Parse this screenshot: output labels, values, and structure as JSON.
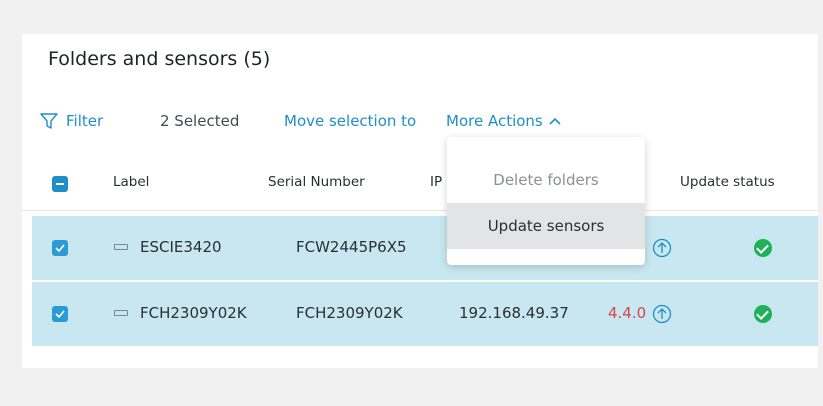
{
  "panel": {
    "title": "Folders and sensors (5)"
  },
  "toolbar": {
    "filter_label": "Filter",
    "selected_label": "2 Selected",
    "move_label": "Move selection to",
    "more_actions_label": "More Actions"
  },
  "dropdown": {
    "items": [
      {
        "label": "Delete folders",
        "disabled": true
      },
      {
        "label": "Update sensors",
        "disabled": false
      }
    ]
  },
  "table": {
    "columns": {
      "label": "Label",
      "serial": "Serial Number",
      "ip": "IP",
      "update_status": "Update status"
    },
    "rows": [
      {
        "label": "ESCIE3420",
        "serial": "FCW2445P6X5",
        "ip": "",
        "version": "",
        "selected": true
      },
      {
        "label": "FCH2309Y02K",
        "serial": "FCH2309Y02K",
        "ip": "192.168.49.37",
        "version": "4.4.0",
        "selected": true
      }
    ]
  },
  "colors": {
    "accent": "#1e8fc8",
    "row_selected": "#c8e7f0",
    "status_ok": "#1fb15a",
    "version_warning": "#d64545"
  }
}
